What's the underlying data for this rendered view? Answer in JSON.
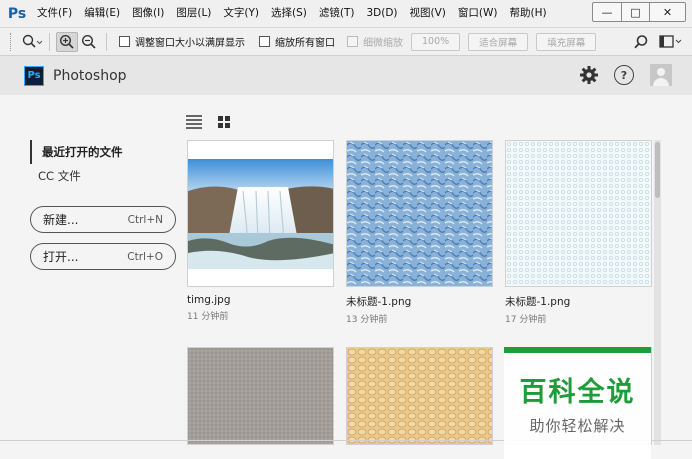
{
  "app": {
    "logo": "Ps",
    "menu": [
      "文件(F)",
      "编辑(E)",
      "图像(I)",
      "图层(L)",
      "文字(Y)",
      "选择(S)",
      "滤镜(T)",
      "3D(D)",
      "视图(V)",
      "窗口(W)",
      "帮助(H)"
    ],
    "window_controls": {
      "minimize": "—",
      "maximize": "□",
      "close": "✕"
    }
  },
  "options_bar": {
    "zoom_dropdown_icon": "zoom-icon",
    "checkbox_resize_windows": "调整窗口大小以满屏显示",
    "checkbox_zoom_all": "缩放所有窗口",
    "checkbox_scrubby_zoom": "细微缩放",
    "zoom_percent": "100%",
    "fit_screen": "适合屏幕",
    "fill_screen": "填充屏幕"
  },
  "home": {
    "badge": "Ps",
    "title": "Photoshop"
  },
  "sidebar": {
    "recent": "最近打开的文件",
    "cc_files": "CC 文件",
    "new_label": "新建...",
    "new_shortcut": "Ctrl+N",
    "open_label": "打开...",
    "open_shortcut": "Ctrl+O"
  },
  "files": [
    {
      "name": "timg.jpg",
      "time": "11 分钟前"
    },
    {
      "name": "未标题-1.png",
      "time": "13 分钟前"
    },
    {
      "name": "未标题-1.png",
      "time": "17 分钟前"
    }
  ],
  "watermark": {
    "main": "百科全说",
    "sub": "助你轻松解决"
  },
  "colors": {
    "ps_blue": "#31a8ff",
    "watermark_green": "#1f9c3a"
  }
}
